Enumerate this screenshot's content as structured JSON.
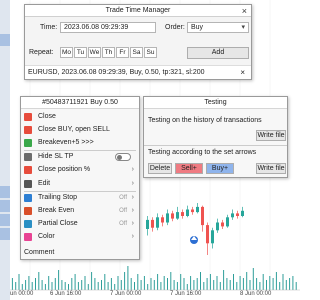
{
  "chart": {
    "bull_color": "#26a69a",
    "bear_color": "#ef5350",
    "volume_color": "#2f9e9a",
    "candles": [
      {
        "o": 35,
        "c": 42,
        "h": 45,
        "l": 30
      },
      {
        "o": 42,
        "c": 36,
        "h": 44,
        "l": 33
      },
      {
        "o": 36,
        "c": 44,
        "h": 47,
        "l": 34
      },
      {
        "o": 44,
        "c": 40,
        "h": 46,
        "l": 37
      },
      {
        "o": 40,
        "c": 47,
        "h": 50,
        "l": 38
      },
      {
        "o": 47,
        "c": 43,
        "h": 49,
        "l": 41
      },
      {
        "o": 43,
        "c": 48,
        "h": 52,
        "l": 42
      },
      {
        "o": 48,
        "c": 45,
        "h": 50,
        "l": 43
      },
      {
        "o": 45,
        "c": 50,
        "h": 53,
        "l": 44
      },
      {
        "o": 50,
        "c": 48,
        "h": 52,
        "l": 46
      },
      {
        "o": 48,
        "c": 52,
        "h": 55,
        "l": 47
      },
      {
        "o": 52,
        "c": 38,
        "h": 53,
        "l": 33
      },
      {
        "o": 38,
        "c": 24,
        "h": 40,
        "l": 15
      },
      {
        "o": 24,
        "c": 34,
        "h": 36,
        "l": 20
      },
      {
        "o": 34,
        "c": 40,
        "h": 43,
        "l": 32
      },
      {
        "o": 40,
        "c": 37,
        "h": 42,
        "l": 35
      },
      {
        "o": 37,
        "c": 44,
        "h": 46,
        "l": 36
      },
      {
        "o": 44,
        "c": 47,
        "h": 50,
        "l": 42
      },
      {
        "o": 47,
        "c": 45,
        "h": 49,
        "l": 43
      },
      {
        "o": 45,
        "c": 49,
        "h": 52,
        "l": 44
      }
    ],
    "volumes": [
      3,
      5,
      2,
      6,
      4,
      8,
      3,
      5,
      7,
      4,
      6,
      9,
      5,
      3,
      7,
      4,
      6,
      10,
      5,
      4,
      3,
      6,
      8,
      4,
      5,
      7,
      3,
      9,
      6,
      4,
      5,
      8,
      4,
      6,
      3,
      7,
      5,
      9,
      12,
      6,
      4,
      8,
      5,
      7,
      3,
      6,
      5,
      8,
      4,
      7,
      6,
      9,
      5,
      4,
      8,
      6,
      3,
      7,
      5,
      6,
      9,
      4,
      6,
      8,
      5,
      7,
      4,
      10,
      6,
      5,
      8,
      4,
      7,
      6,
      9,
      5,
      11,
      6,
      4,
      8,
      5,
      7,
      6,
      9,
      4,
      8,
      5,
      6,
      7,
      4
    ],
    "x_labels": [
      "6 Jun 00:00",
      "6 Jun 16:00",
      "7 Jun 00:00",
      "7 Jun 16:00",
      "8 Jun 00:00"
    ]
  },
  "trade_time_manager": {
    "title": "Trade Time Manager",
    "close": "×",
    "time_label": "Time:",
    "time_value": "2023.06.08 09:29:39",
    "order_label": "Order:",
    "order_value": "Buy",
    "repeat_label": "Repeat:",
    "days": [
      "Mo",
      "Tu",
      "We",
      "Th",
      "Fr",
      "Sa",
      "Su"
    ],
    "add_label": "Add",
    "entry": "EURUSD, 2023.06.08 09:29:39, Buy, 0.50, tp:321, sl:200",
    "entry_close": "×"
  },
  "menu": {
    "title": "#50483711921 Buy 0.50",
    "items": [
      {
        "label": "Close",
        "icon_color": "#e74c3c",
        "icon": "close-icon"
      },
      {
        "label": "Close BUY, open SELL",
        "icon_color": "#e74c3c",
        "icon": "reverse-icon"
      },
      {
        "label": "Breakeven+5 >>>",
        "icon_color": "#3aa84a",
        "icon": "breakeven-icon"
      },
      {
        "label": "Hide SL TP",
        "icon_color": "#6c6c6c",
        "icon": "hide-icon"
      },
      {
        "label": "Close position %",
        "icon_color": "#e74c3c",
        "icon": "percent-icon"
      },
      {
        "label": "Edit",
        "icon_color": "#555555",
        "icon": "edit-icon"
      },
      {
        "label": "Trailing Stop",
        "icon_color": "#2d7fd3",
        "icon": "trailing-icon",
        "state": "Off"
      },
      {
        "label": "Break Even",
        "icon_color": "#d94f2a",
        "icon": "break-even-icon",
        "state": "Off"
      },
      {
        "label": "Partial Close",
        "icon_color": "#2a8fc4",
        "icon": "partial-close-icon",
        "state": "Off"
      },
      {
        "label": "Color",
        "icon_color": "#e84393",
        "icon": "color-icon"
      }
    ],
    "comment_label": "Comment"
  },
  "testing": {
    "title": "Testing",
    "history_text": "Testing on the history of transactions",
    "write_file": "Write file",
    "arrows_text": "Testing according to the set arrows",
    "delete": "Delete",
    "sell": "Sell+",
    "buy": "Buy+",
    "write_file2": "Write file",
    "sell_color": "#ef7b82",
    "buy_color": "#8fb4ec"
  }
}
